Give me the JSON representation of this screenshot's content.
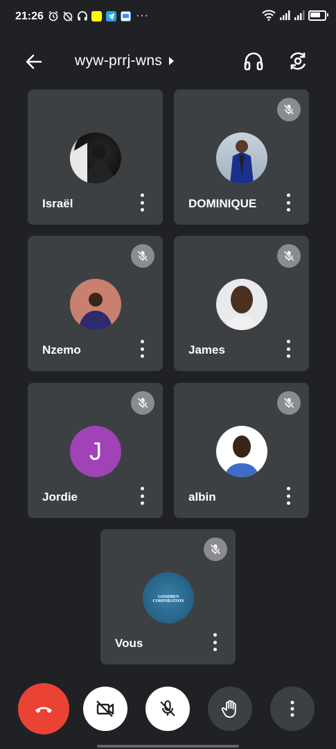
{
  "status_bar": {
    "time": "21:26",
    "battery_level": 0.75,
    "icons": [
      "alarm-icon",
      "alarm-off-icon",
      "headset-icon",
      "snapchat-icon",
      "telegram-icon",
      "calendar-icon",
      "wifi-icon",
      "signal-icon",
      "signal-icon",
      "battery-icon"
    ],
    "more": "···"
  },
  "top_bar": {
    "meeting_code": "wyw-prrj-wns"
  },
  "participants": [
    {
      "name": "Israël",
      "muted": false,
      "avatar": "photo"
    },
    {
      "name": "DOMINIQUE",
      "muted": true,
      "avatar": "photo"
    },
    {
      "name": "Nzemo",
      "muted": true,
      "avatar": "photo"
    },
    {
      "name": "James",
      "muted": true,
      "avatar": "photo"
    },
    {
      "name": "Jordie",
      "muted": true,
      "avatar": "initial",
      "initial": "J",
      "color": "#a142b8"
    },
    {
      "name": "albin",
      "muted": true,
      "avatar": "photo"
    },
    {
      "name": "Vous",
      "muted": true,
      "avatar": "logo",
      "logo_text_1": "GOODBEN",
      "logo_text_2": "CORPORATION"
    }
  ],
  "colors": {
    "background": "#202124",
    "tile": "#3c4043",
    "end_call": "#ea4335",
    "muted_badge": "#8a8c8f"
  },
  "controls": {
    "end_call": "end-call-icon",
    "camera": "camera-off-icon",
    "microphone": "mic-off-icon",
    "raise_hand": "hand-icon",
    "more": "more-vertical-icon"
  }
}
